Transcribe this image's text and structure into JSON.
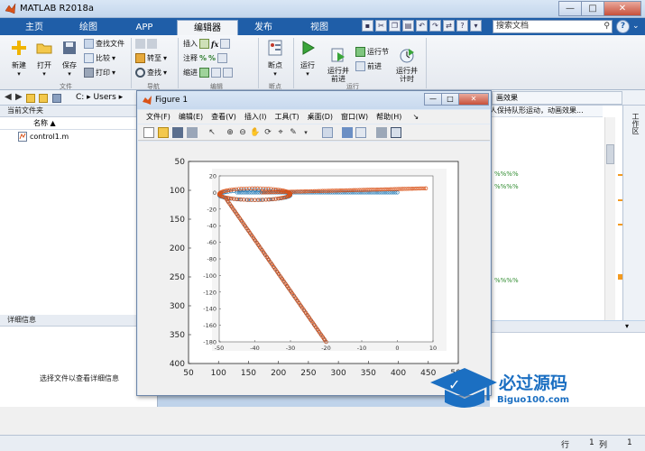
{
  "app": {
    "title": "MATLAB R2018a",
    "window_buttons": {
      "minimize": "—",
      "maximize": "□",
      "close": "✕"
    }
  },
  "ribbon_tabs": [
    "主页",
    "绘图",
    "APP",
    "编辑器",
    "发布",
    "视图"
  ],
  "search": {
    "placeholder": "搜索文档"
  },
  "ribbon": {
    "new": "新建",
    "open": "打开",
    "save": "保存",
    "find_files": "查找文件",
    "compare": "比较",
    "print": "打印",
    "goto": "转至",
    "find": "查找",
    "insert": "插入",
    "comment": "注释",
    "indent": "缩进",
    "breakpoints": "断点",
    "run": "运行",
    "run_advance": "运行并\n前进",
    "run_section": "运行节",
    "advance": "前进",
    "run_time": "运行并\n计时",
    "groups": {
      "file": "文件",
      "navigate": "导航",
      "edit": "编辑",
      "breakpoints": "断点",
      "run": "运行"
    }
  },
  "address": {
    "path": "C: ▸ Users ▸"
  },
  "left_panel": {
    "title": "当前文件夹",
    "name_col": "名称 ▲",
    "file": "control1.m",
    "details_title": "详细信息",
    "details_text": "选择文件以查看详细信息"
  },
  "editor": {
    "tab_label": "画效果",
    "title_line": "人保持队形运动，动画效果...",
    "comment_marks": "%%%%"
  },
  "right_strip": {
    "label": "工作区"
  },
  "status": {
    "row_label": "行",
    "row": "1",
    "col_label": "列",
    "col": "1"
  },
  "figure": {
    "title": "Figure 1",
    "menu": [
      "文件(F)",
      "编辑(E)",
      "查看(V)",
      "插入(I)",
      "工具(T)",
      "桌面(D)",
      "窗口(W)",
      "帮助(H)"
    ]
  },
  "watermark": {
    "title": "必过源码",
    "url": "Biguo100.com"
  },
  "colors": {
    "series_blue": "#1f77b4",
    "series_orange": "#d95319",
    "ribbon_blue": "#1f5ea8"
  },
  "chart_data": [
    {
      "type": "scatter",
      "role": "outer-axes",
      "xlim": [
        50,
        500
      ],
      "ylim": [
        400,
        50
      ],
      "x_ticks": [
        50,
        100,
        150,
        200,
        250,
        300,
        350,
        400,
        450,
        500
      ],
      "y_ticks": [
        50,
        100,
        150,
        200,
        250,
        300,
        350,
        400
      ],
      "series": []
    },
    {
      "type": "scatter",
      "role": "inner-axes",
      "xlim": [
        -50,
        10
      ],
      "ylim": [
        -180,
        20
      ],
      "x_ticks": [
        -50,
        -40,
        -30,
        -20,
        -10,
        0,
        10
      ],
      "y_ticks": [
        20,
        0,
        -20,
        -40,
        -60,
        -80,
        -100,
        -120,
        -140,
        -160,
        -180
      ],
      "series": [
        {
          "marker": "o",
          "color": "#1f77b4",
          "segments": [
            {
              "kind": "line",
              "from": [
                -20,
                -180
              ],
              "to": [
                -48,
                -8
              ],
              "n": 60
            },
            {
              "kind": "loop",
              "center": [
                -40,
                -3
              ],
              "rx": 10,
              "ry": 6,
              "n": 60
            },
            {
              "kind": "line",
              "from": [
                -45,
                0
              ],
              "to": [
                0,
                0
              ],
              "n": 80
            }
          ]
        },
        {
          "marker": "o",
          "color": "#d95319",
          "segments": [
            {
              "kind": "line",
              "from": [
                -20,
                -180
              ],
              "to": [
                -48,
                -8
              ],
              "n": 90
            },
            {
              "kind": "loop",
              "center": [
                -40,
                -2
              ],
              "rx": 10,
              "ry": 7,
              "n": 80
            },
            {
              "kind": "line",
              "from": [
                -38,
                0
              ],
              "to": [
                8,
                5
              ],
              "n": 85
            }
          ]
        }
      ]
    }
  ]
}
